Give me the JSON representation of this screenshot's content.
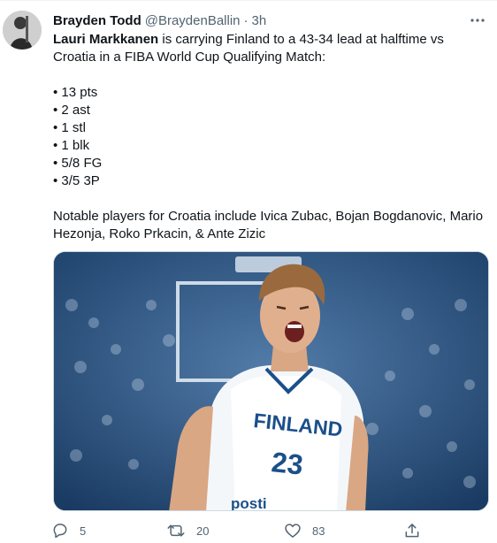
{
  "tweet": {
    "author_name": "Brayden Todd",
    "author_handle": "@BraydenBallin",
    "separator": "·",
    "time": "3h",
    "lead_name": "Lauri Markkanen",
    "lead_rest": " is carrying Finland to a 43-34 lead at halftime vs Croatia in a FIBA World Cup Qualifying Match:",
    "stats": [
      "• 13 pts",
      "• 2 ast",
      "• 1 stl",
      "• 1 blk",
      "• 5/8 FG",
      "• 3/5 3P"
    ],
    "closing": "Notable players for Croatia include Ivica Zubac, Bojan Bogdanovic, Mario Hezonja, Roko Prkacin, & Ante Zizic",
    "image": {
      "jersey_text": "FINLAND",
      "jersey_number": "23",
      "jersey_sponsor": "posti"
    }
  },
  "actions": {
    "reply_count": "5",
    "retweet_count": "20",
    "like_count": "83"
  },
  "colors": {
    "text": "#0f1419",
    "secondary": "#536471",
    "border": "#cfd9de"
  },
  "icons": [
    "more-icon",
    "reply-icon",
    "retweet-icon",
    "like-icon",
    "share-icon"
  ]
}
